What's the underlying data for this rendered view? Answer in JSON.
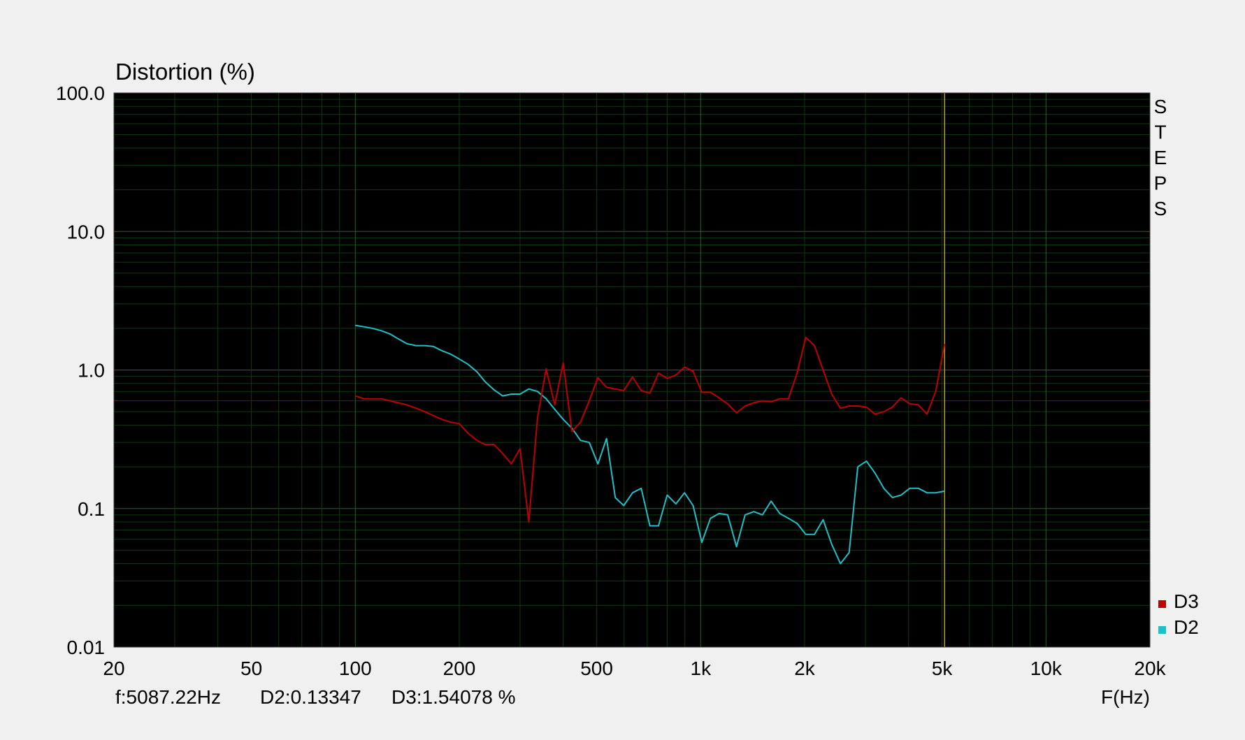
{
  "chart_data": {
    "type": "line",
    "title": "Distortion (%)",
    "xlabel": "F(Hz)",
    "x_scale": "log",
    "y_scale": "log",
    "xlim": [
      20,
      20000
    ],
    "ylim": [
      0.01,
      100
    ],
    "grid": true,
    "x_ticks": [
      {
        "value": 20,
        "label": "20"
      },
      {
        "value": 50,
        "label": "50"
      },
      {
        "value": 100,
        "label": "100"
      },
      {
        "value": 200,
        "label": "200"
      },
      {
        "value": 500,
        "label": "500"
      },
      {
        "value": 1000,
        "label": "1k"
      },
      {
        "value": 2000,
        "label": "2k"
      },
      {
        "value": 5000,
        "label": "5k"
      },
      {
        "value": 10000,
        "label": "10k"
      },
      {
        "value": 20000,
        "label": "20k"
      }
    ],
    "y_ticks": [
      {
        "value": 100,
        "label": "100.0"
      },
      {
        "value": 10,
        "label": "10.0"
      },
      {
        "value": 1,
        "label": "1.0"
      },
      {
        "value": 0.1,
        "label": "0.1"
      },
      {
        "value": 0.01,
        "label": "0.01"
      }
    ],
    "side_label": [
      "S",
      "T",
      "E",
      "P",
      "S"
    ],
    "cursor": {
      "frequency": 5087.22,
      "readout": [
        "f:5087.22Hz",
        "D2:0.13347",
        "D3:1.54078 %"
      ]
    },
    "legend_position": "bottom-right",
    "series": [
      {
        "name": "D3",
        "color": "#c00000",
        "x": [
          100,
          106,
          112,
          119,
          126,
          133,
          141,
          150,
          159,
          168,
          178,
          189,
          200,
          212,
          225,
          238,
          252,
          267,
          283,
          300,
          318,
          337,
          357,
          378,
          400,
          424,
          449,
          476,
          504,
          534,
          566,
          599,
          635,
          673,
          713,
          755,
          800,
          848,
          898,
          951,
          1008,
          1068,
          1131,
          1198,
          1270,
          1345,
          1425,
          1510,
          1600,
          1695,
          1796,
          1903,
          2016,
          2136,
          2263,
          2398,
          2540,
          2691,
          2851,
          3021,
          3200,
          3391,
          3592,
          3806,
          4032,
          4272,
          4526,
          4795,
          5087
        ],
        "values": [
          0.65,
          0.62,
          0.62,
          0.62,
          0.6,
          0.58,
          0.56,
          0.53,
          0.5,
          0.47,
          0.44,
          0.42,
          0.41,
          0.35,
          0.31,
          0.29,
          0.29,
          0.25,
          0.21,
          0.27,
          0.08,
          0.45,
          1.02,
          0.56,
          1.12,
          0.36,
          0.42,
          0.6,
          0.88,
          0.75,
          0.73,
          0.71,
          0.89,
          0.71,
          0.68,
          0.95,
          0.87,
          0.92,
          1.05,
          0.98,
          0.69,
          0.69,
          0.63,
          0.57,
          0.49,
          0.55,
          0.58,
          0.6,
          0.59,
          0.62,
          0.62,
          0.95,
          1.72,
          1.5,
          1.0,
          0.67,
          0.53,
          0.55,
          0.55,
          0.54,
          0.48,
          0.5,
          0.54,
          0.63,
          0.57,
          0.56,
          0.48,
          0.7,
          1.54
        ]
      },
      {
        "name": "D2",
        "color": "#20c0c8",
        "x": [
          100,
          106,
          112,
          119,
          126,
          133,
          141,
          150,
          159,
          168,
          178,
          189,
          200,
          212,
          225,
          238,
          252,
          267,
          283,
          300,
          318,
          337,
          357,
          378,
          400,
          424,
          449,
          476,
          504,
          534,
          566,
          599,
          635,
          673,
          713,
          755,
          800,
          848,
          898,
          951,
          1008,
          1068,
          1131,
          1198,
          1270,
          1345,
          1425,
          1510,
          1600,
          1695,
          1796,
          1903,
          2016,
          2136,
          2263,
          2398,
          2540,
          2691,
          2851,
          3021,
          3200,
          3391,
          3592,
          3806,
          4032,
          4272,
          4526,
          4795,
          5087
        ],
        "values": [
          2.1,
          2.05,
          2.0,
          1.92,
          1.82,
          1.68,
          1.55,
          1.5,
          1.5,
          1.48,
          1.38,
          1.3,
          1.2,
          1.1,
          0.97,
          0.82,
          0.72,
          0.65,
          0.67,
          0.67,
          0.73,
          0.7,
          0.62,
          0.52,
          0.44,
          0.38,
          0.31,
          0.3,
          0.21,
          0.32,
          0.12,
          0.105,
          0.13,
          0.14,
          0.075,
          0.075,
          0.125,
          0.108,
          0.13,
          0.105,
          0.057,
          0.085,
          0.092,
          0.09,
          0.053,
          0.09,
          0.095,
          0.09,
          0.113,
          0.092,
          0.085,
          0.078,
          0.065,
          0.065,
          0.083,
          0.055,
          0.04,
          0.048,
          0.2,
          0.22,
          0.18,
          0.14,
          0.12,
          0.125,
          0.14,
          0.14,
          0.13,
          0.13,
          0.13347
        ]
      }
    ]
  },
  "colors": {
    "background": "#f0f0f0",
    "plot_background": "#000000",
    "grid_major": "#1f6b1f",
    "grid_minor": "#0f3a0f",
    "cursor": "#b0a030"
  }
}
